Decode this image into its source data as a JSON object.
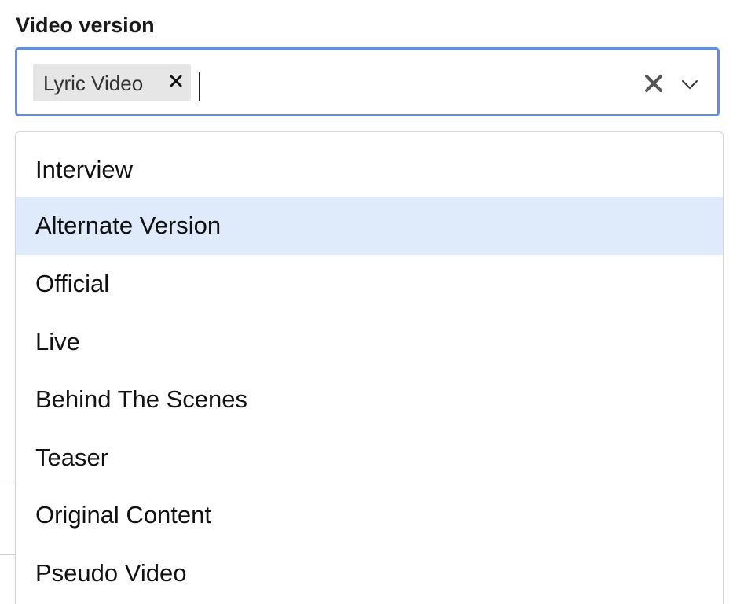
{
  "field": {
    "label": "Video version"
  },
  "select": {
    "selected_chips": [
      {
        "label": "Lyric Video"
      }
    ],
    "input_value": "",
    "clear_icon": "close-icon",
    "toggle_icon": "chevron-down-icon"
  },
  "menu": {
    "highlighted_index": 1,
    "options": [
      {
        "label": "Interview"
      },
      {
        "label": "Alternate Version"
      },
      {
        "label": "Official"
      },
      {
        "label": "Live"
      },
      {
        "label": "Behind The Scenes"
      },
      {
        "label": "Teaser"
      },
      {
        "label": "Original Content"
      },
      {
        "label": "Pseudo Video"
      }
    ]
  },
  "colors": {
    "focus_border": "#5b8ef0",
    "highlight": "#dfeafb",
    "chip_bg": "#e6e6e6"
  }
}
